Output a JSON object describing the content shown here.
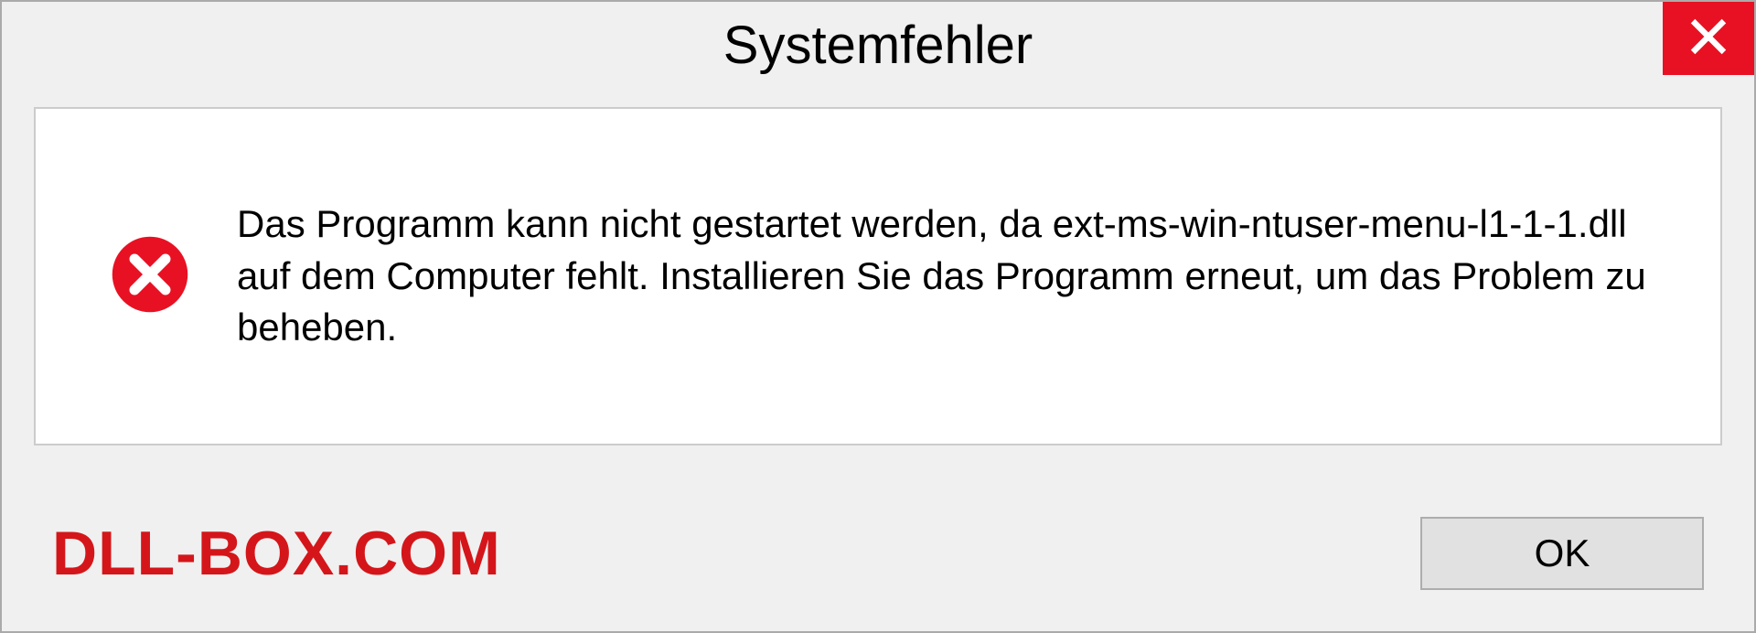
{
  "dialog": {
    "title": "Systemfehler",
    "message": "Das Programm kann nicht gestartet werden, da ext-ms-win-ntuser-menu-l1-1-1.dll auf dem Computer fehlt. Installieren Sie das Programm erneut, um das Problem zu beheben.",
    "ok_label": "OK"
  },
  "watermark": "DLL-BOX.COM"
}
